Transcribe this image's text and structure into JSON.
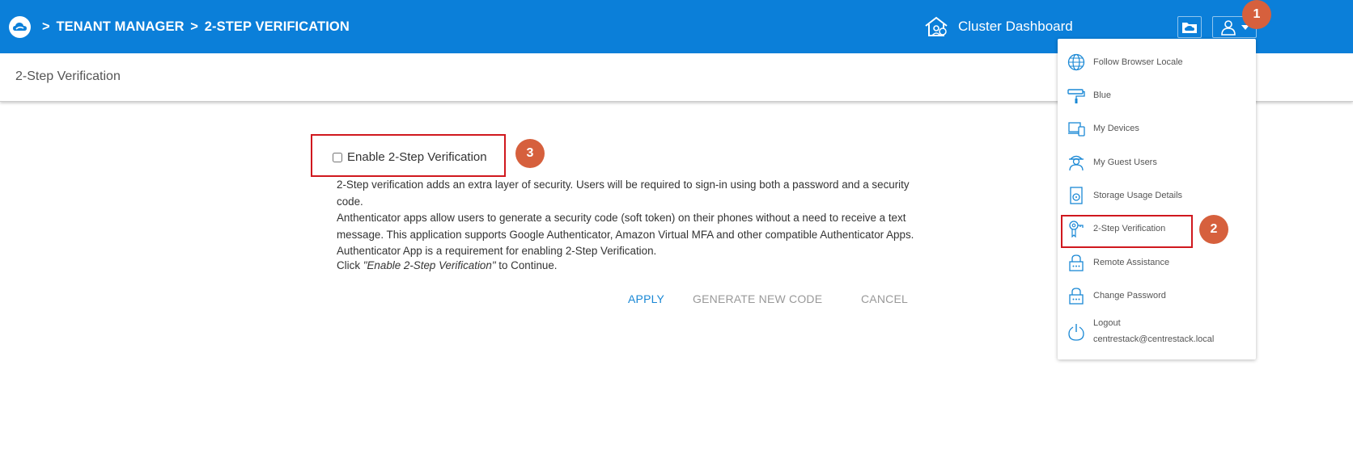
{
  "header": {
    "breadcrumb": [
      ">",
      "TENANT MANAGER",
      ">",
      "2-STEP VERIFICATION"
    ],
    "cluster_dashboard": "Cluster Dashboard",
    "background_color": "#0b7fd9"
  },
  "subheader": {
    "title": "2-Step Verification"
  },
  "callouts": {
    "one": "1",
    "two": "2",
    "three": "3",
    "color": "#d6603d"
  },
  "enable": {
    "label": "Enable 2-Step Verification",
    "checked": false
  },
  "description": {
    "line1": "2-Step verification adds an extra layer of security. Users will be required to sign-in using both a password and a security code.",
    "line2": "Anthenticator apps allow users to generate a security code (soft token) on their phones without a need to receive a text",
    "line3": "message. This application supports Google Authenticator, Amazon Virtual MFA and other compatible Authenticator Apps.",
    "line4": "Authenticator App is a requirement for enabling 2-Step Verification."
  },
  "continue_text": {
    "prefix": "Click ",
    "quote": "\"Enable 2-Step Verification\"",
    "suffix": " to Continue."
  },
  "actions": {
    "apply": "APPLY",
    "generate": "GENERATE NEW CODE",
    "cancel": "CANCEL"
  },
  "menu": {
    "items": [
      {
        "label": "Follow Browser Locale",
        "icon": "globe-icon"
      },
      {
        "label": "Blue",
        "icon": "paint-roller-icon"
      },
      {
        "label": "My Devices",
        "icon": "devices-icon"
      },
      {
        "label": "My Guest Users",
        "icon": "guest-user-icon"
      },
      {
        "label": "Storage Usage Details",
        "icon": "storage-disk-icon"
      },
      {
        "label": "2-Step Verification",
        "icon": "key-badge-icon"
      },
      {
        "label": "Remote Assistance",
        "icon": "lock-icon"
      },
      {
        "label": "Change Password",
        "icon": "lock-icon"
      },
      {
        "label": "Logout",
        "sublabel": "centrestack@centrestack.local",
        "icon": "power-icon"
      }
    ],
    "icon_color": "#1a88d5",
    "highlight_color": "#d0181e"
  }
}
